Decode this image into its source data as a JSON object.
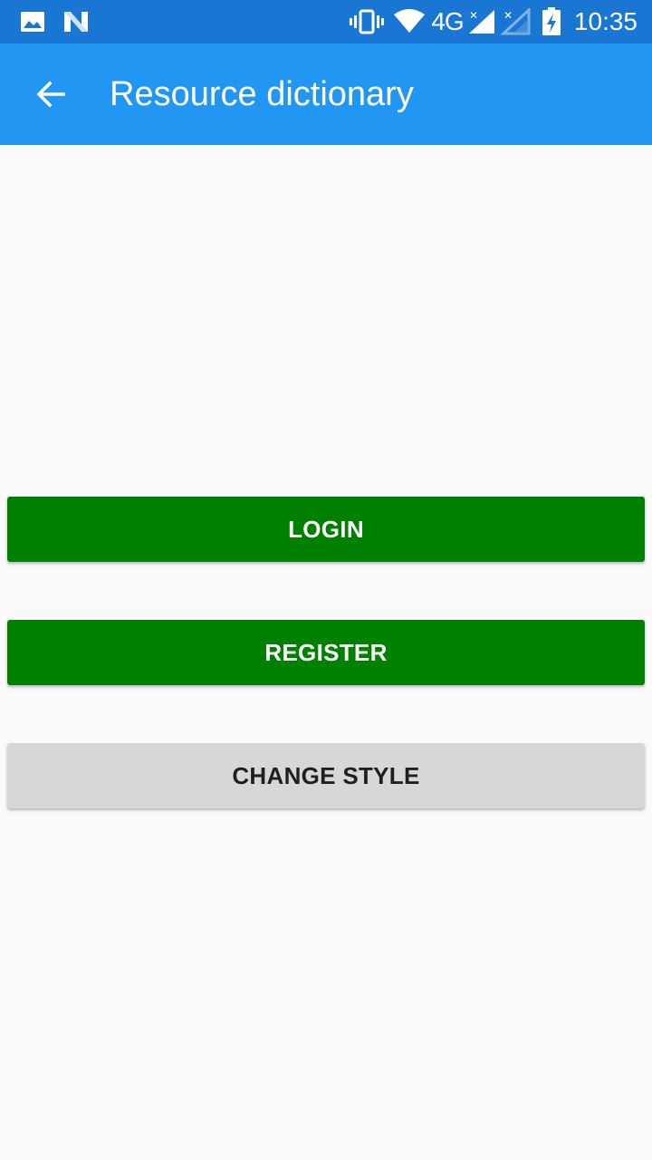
{
  "status_bar": {
    "time": "10:35",
    "network": "4G",
    "icons": [
      "image-icon",
      "n-notification-icon",
      "vibrate-icon",
      "wifi-icon",
      "signal-icon",
      "signal-2-icon",
      "battery-charging-icon"
    ]
  },
  "app_bar": {
    "title": "Resource dictionary",
    "back_icon": "arrow-back-icon",
    "color": "#2196f3"
  },
  "buttons": {
    "login": "LOGIN",
    "register": "REGISTER",
    "change_style": "CHANGE STYLE"
  },
  "colors": {
    "primary_button": "#008000",
    "secondary_button": "#d6d7d7",
    "status_bar": "#1976d2"
  }
}
